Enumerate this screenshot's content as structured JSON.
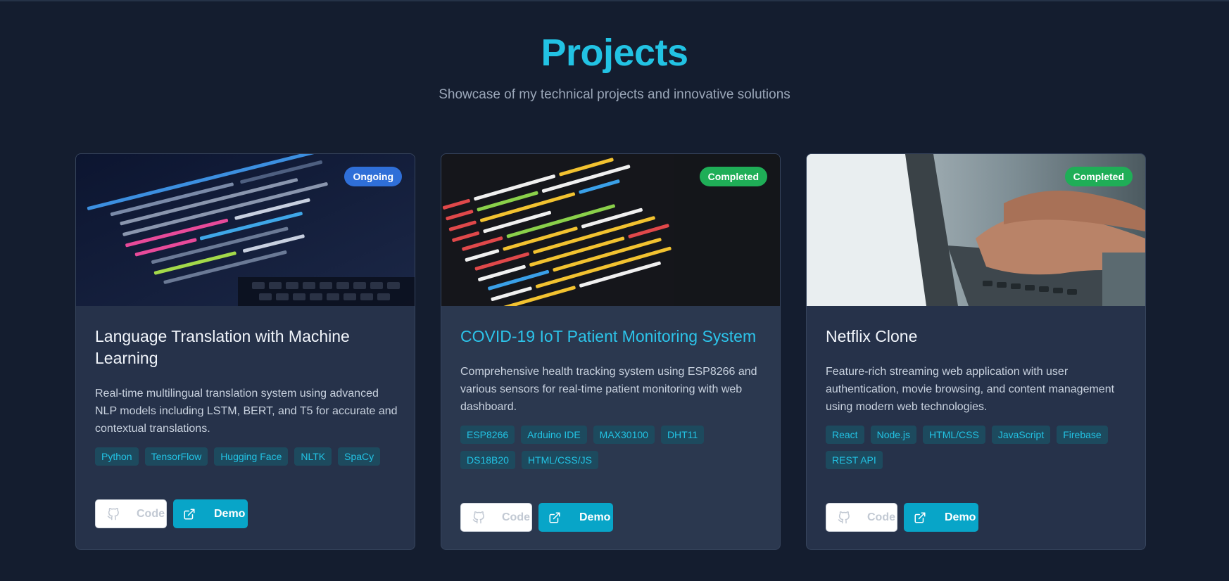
{
  "header": {
    "title": "Projects",
    "subtitle": "Showcase of my technical projects and innovative solutions"
  },
  "colors": {
    "background": "#141d2f",
    "accent": "#22c3e4",
    "ongoing": "#2f6fd8",
    "completed": "#1fae57",
    "demo_button": "#08a5c8"
  },
  "projects": [
    {
      "status": "Ongoing",
      "title": "Language Translation with Machine Learning",
      "description": "Real-time multilingual translation system using advanced NLP models including LSTM, BERT, and T5 for accurate and contextual translations.",
      "tags": [
        "Python",
        "TensorFlow",
        "Hugging Face",
        "NLTK",
        "SpaCy"
      ],
      "code_label": "Code",
      "demo_label": "Demo"
    },
    {
      "status": "Completed",
      "title": "COVID-19 IoT Patient Monitoring System",
      "description": "Comprehensive health tracking system using ESP8266 and various sensors for real-time patient monitoring with web dashboard.",
      "tags": [
        "ESP8266",
        "Arduino IDE",
        "MAX30100",
        "DHT11",
        "DS18B20",
        "HTML/CSS/JS"
      ],
      "code_label": "Code",
      "demo_label": "Demo"
    },
    {
      "status": "Completed",
      "title": "Netflix Clone",
      "description": "Feature-rich streaming web application with user authentication, movie browsing, and content management using modern web technologies.",
      "tags": [
        "React",
        "Node.js",
        "HTML/CSS",
        "JavaScript",
        "Firebase",
        "REST API"
      ],
      "code_label": "Code",
      "demo_label": "Demo"
    }
  ]
}
